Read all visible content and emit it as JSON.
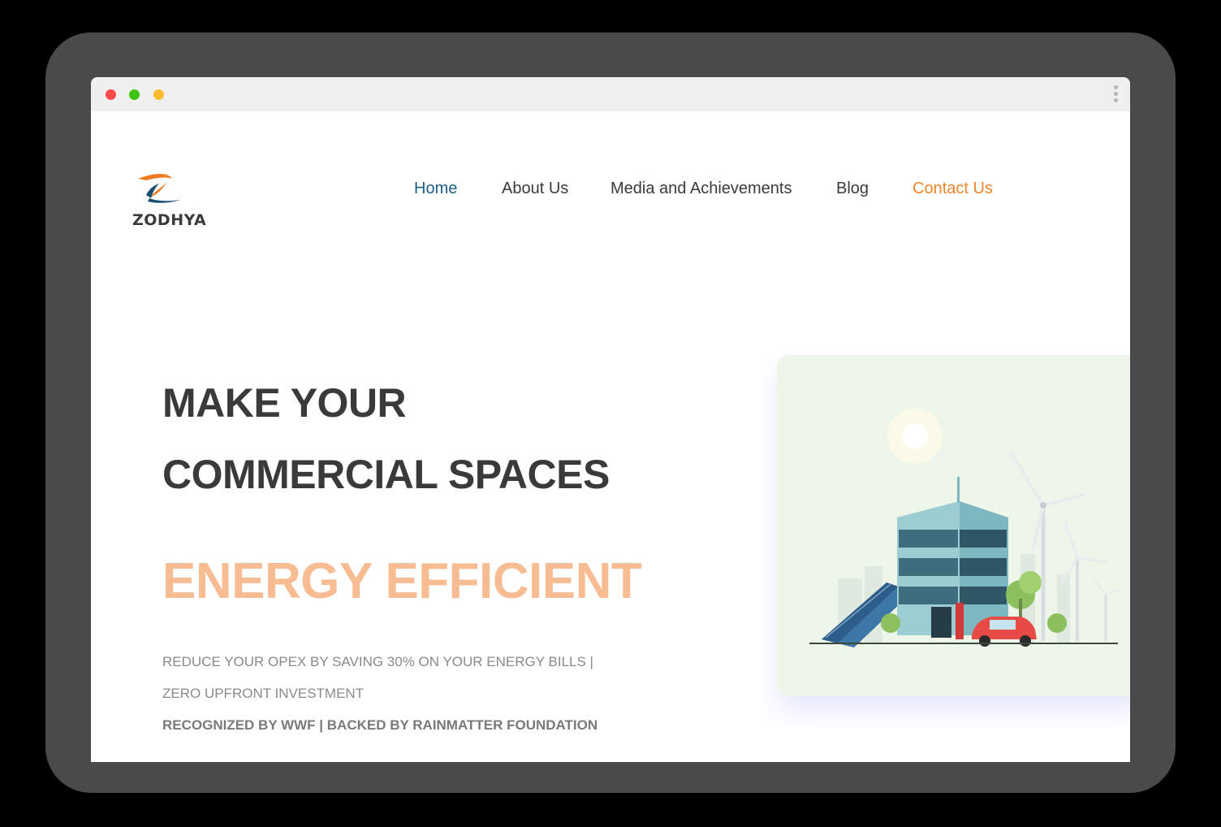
{
  "browser": {
    "controls": [
      "close",
      "minimize",
      "maximize"
    ],
    "menu_icon": "vertical-dots-icon"
  },
  "brand": {
    "name": "ZODHYA",
    "colors": {
      "orange": "#f07c22",
      "navy": "#1b4f72"
    }
  },
  "nav": {
    "items": [
      {
        "label": "Home",
        "state": "active"
      },
      {
        "label": "About Us"
      },
      {
        "label": "Media and Achievements"
      },
      {
        "label": "Blog"
      },
      {
        "label": "Contact Us",
        "state": "highlight"
      }
    ],
    "colors": {
      "active": "#1b5e84",
      "highlight": "#f0852a",
      "default": "#3a3a3a"
    }
  },
  "hero": {
    "line1": "MAKE YOUR",
    "line2": "COMMERCIAL SPACES",
    "line3": "ENERGY EFFICIENT",
    "line3_color": "#f8bc92",
    "subline1": "REDUCE YOUR OPEX BY SAVING 30% ON YOUR ENERGY BILLS |",
    "subline2": "ZERO UPFRONT INVESTMENT",
    "subline3": "RECOGNIZED BY WWF | BACKED BY RAINMATTER FOUNDATION"
  },
  "illustration": {
    "subject": "building-solar-wind-ev-illustration"
  }
}
